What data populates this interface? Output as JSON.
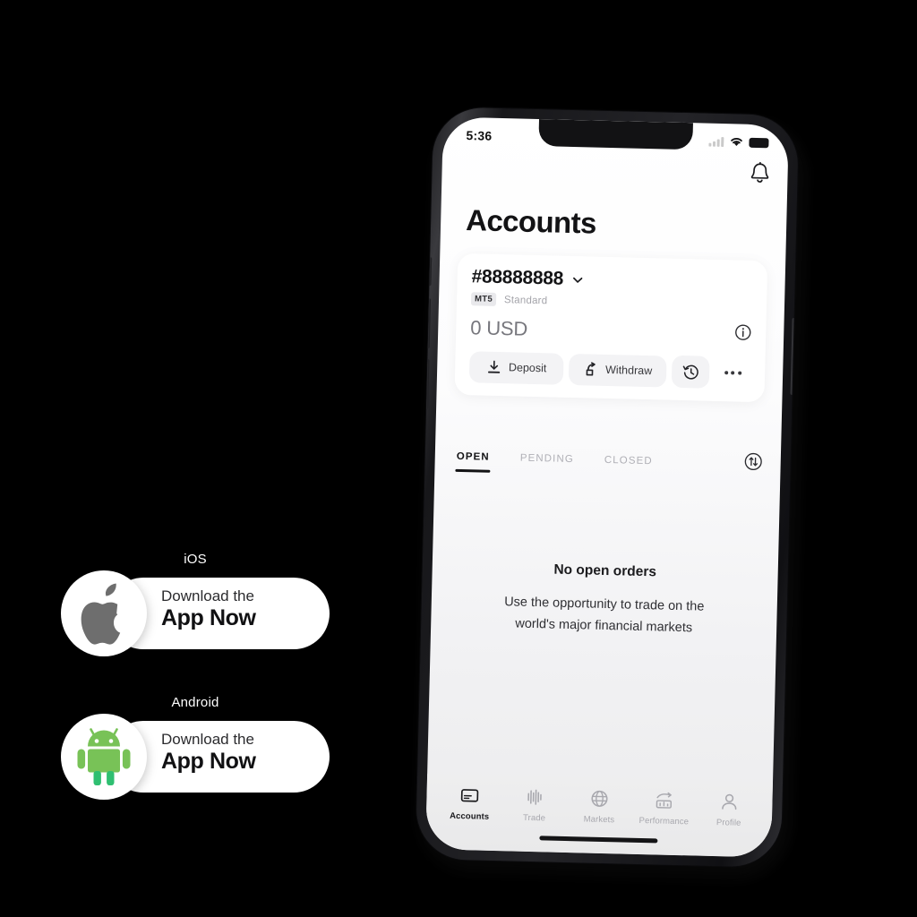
{
  "phone": {
    "status_bar": {
      "time": "5:36",
      "icons": [
        "signal-icon",
        "wifi-icon",
        "battery-icon"
      ]
    },
    "header": {
      "title": "Accounts",
      "notification_icon": "bell-icon"
    },
    "account_card": {
      "account_number": "#88888888",
      "chevron_icon": "chevron-down-icon",
      "platform_badge": "MT5",
      "account_type": "Standard",
      "balance": "0 USD",
      "info_icon": "info-icon",
      "actions": [
        {
          "label": "Deposit",
          "icon": "download-icon"
        },
        {
          "label": "Withdraw",
          "icon": "upload-share-icon"
        }
      ],
      "history_icon": "history-clock-icon",
      "more_icon": "more-horizontal-icon"
    },
    "tabs": [
      {
        "label": "OPEN",
        "active": true
      },
      {
        "label": "PENDING",
        "active": false
      },
      {
        "label": "CLOSED",
        "active": false
      }
    ],
    "sort_icon": "sort-arrows-icon",
    "empty_state": {
      "title": "No open orders",
      "line1": "Use the opportunity to trade on the",
      "line2": "world's major financial markets"
    },
    "bottom_nav": [
      {
        "label": "Accounts",
        "icon": "card-icon",
        "active": true
      },
      {
        "label": "Trade",
        "icon": "candlestick-icon",
        "active": false
      },
      {
        "label": "Markets",
        "icon": "globe-icon",
        "active": false
      },
      {
        "label": "Performance",
        "icon": "bar-chart-trend-icon",
        "active": false
      },
      {
        "label": "Profile",
        "icon": "person-icon",
        "active": false
      }
    ]
  },
  "badges": [
    {
      "os": "iOS",
      "icon": "apple-logo-icon",
      "line1": "Download the",
      "line2": "App Now",
      "icon_color": "#6e6e6e"
    },
    {
      "os": "Android",
      "icon": "android-robot-icon",
      "line1": "Download the",
      "line2": "App Now",
      "icon_color": "#78c257"
    }
  ],
  "colors": {
    "background": "#000000",
    "accent_dark": "#131315",
    "muted": "#a8a8ae",
    "android_green": "#78c257",
    "android_green_dark": "#2fbf71",
    "apple_gray": "#6e6e6e"
  }
}
